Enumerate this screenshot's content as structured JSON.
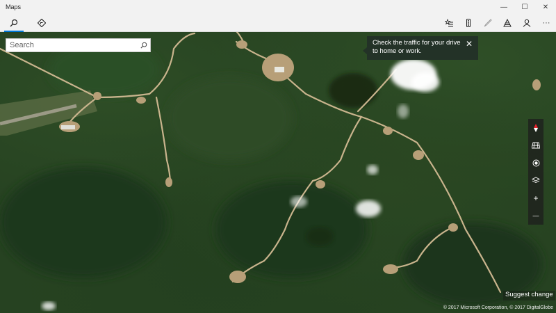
{
  "window": {
    "title": "Maps",
    "controls": {
      "minimize": "—",
      "maximize": "☐",
      "close": "✕"
    }
  },
  "toolbar": {
    "left": [
      {
        "name": "search-tab",
        "icon": "search-icon",
        "active": true
      },
      {
        "name": "directions-tab",
        "icon": "directions-icon",
        "active": false
      }
    ],
    "right": [
      {
        "name": "favorites-button",
        "icon": "favorites-list-icon"
      },
      {
        "name": "traffic-button",
        "icon": "traffic-light-icon"
      },
      {
        "name": "ink-button",
        "icon": "pen-icon"
      },
      {
        "name": "3d-cities-button",
        "icon": "3d-cities-icon"
      },
      {
        "name": "account-button",
        "icon": "person-icon"
      },
      {
        "name": "more-button",
        "icon": "more-icon",
        "glyph": "···"
      }
    ]
  },
  "search": {
    "placeholder": "Search",
    "value": ""
  },
  "tooltip": {
    "text": "Check the traffic for your drive to home or work.",
    "close_glyph": "✕"
  },
  "map_controls": [
    {
      "name": "compass-button",
      "icon": "compass-icon"
    },
    {
      "name": "tilt-button",
      "icon": "grid-tilt-icon"
    },
    {
      "name": "my-location-button",
      "icon": "location-icon"
    },
    {
      "name": "map-views-button",
      "icon": "layers-icon"
    },
    {
      "name": "zoom-in-button",
      "icon": "plus-icon",
      "glyph": "+"
    },
    {
      "name": "zoom-out-button",
      "icon": "minus-icon",
      "glyph": "—"
    }
  ],
  "footer": {
    "suggest": "Suggest change",
    "copyright": "© 2017 Microsoft Corporation, © 2017 DigitalGlobe"
  },
  "colors": {
    "accent": "#0078d7",
    "tooltip_bg": "#233227",
    "forest": "#264221",
    "road": "#c9b48d"
  }
}
